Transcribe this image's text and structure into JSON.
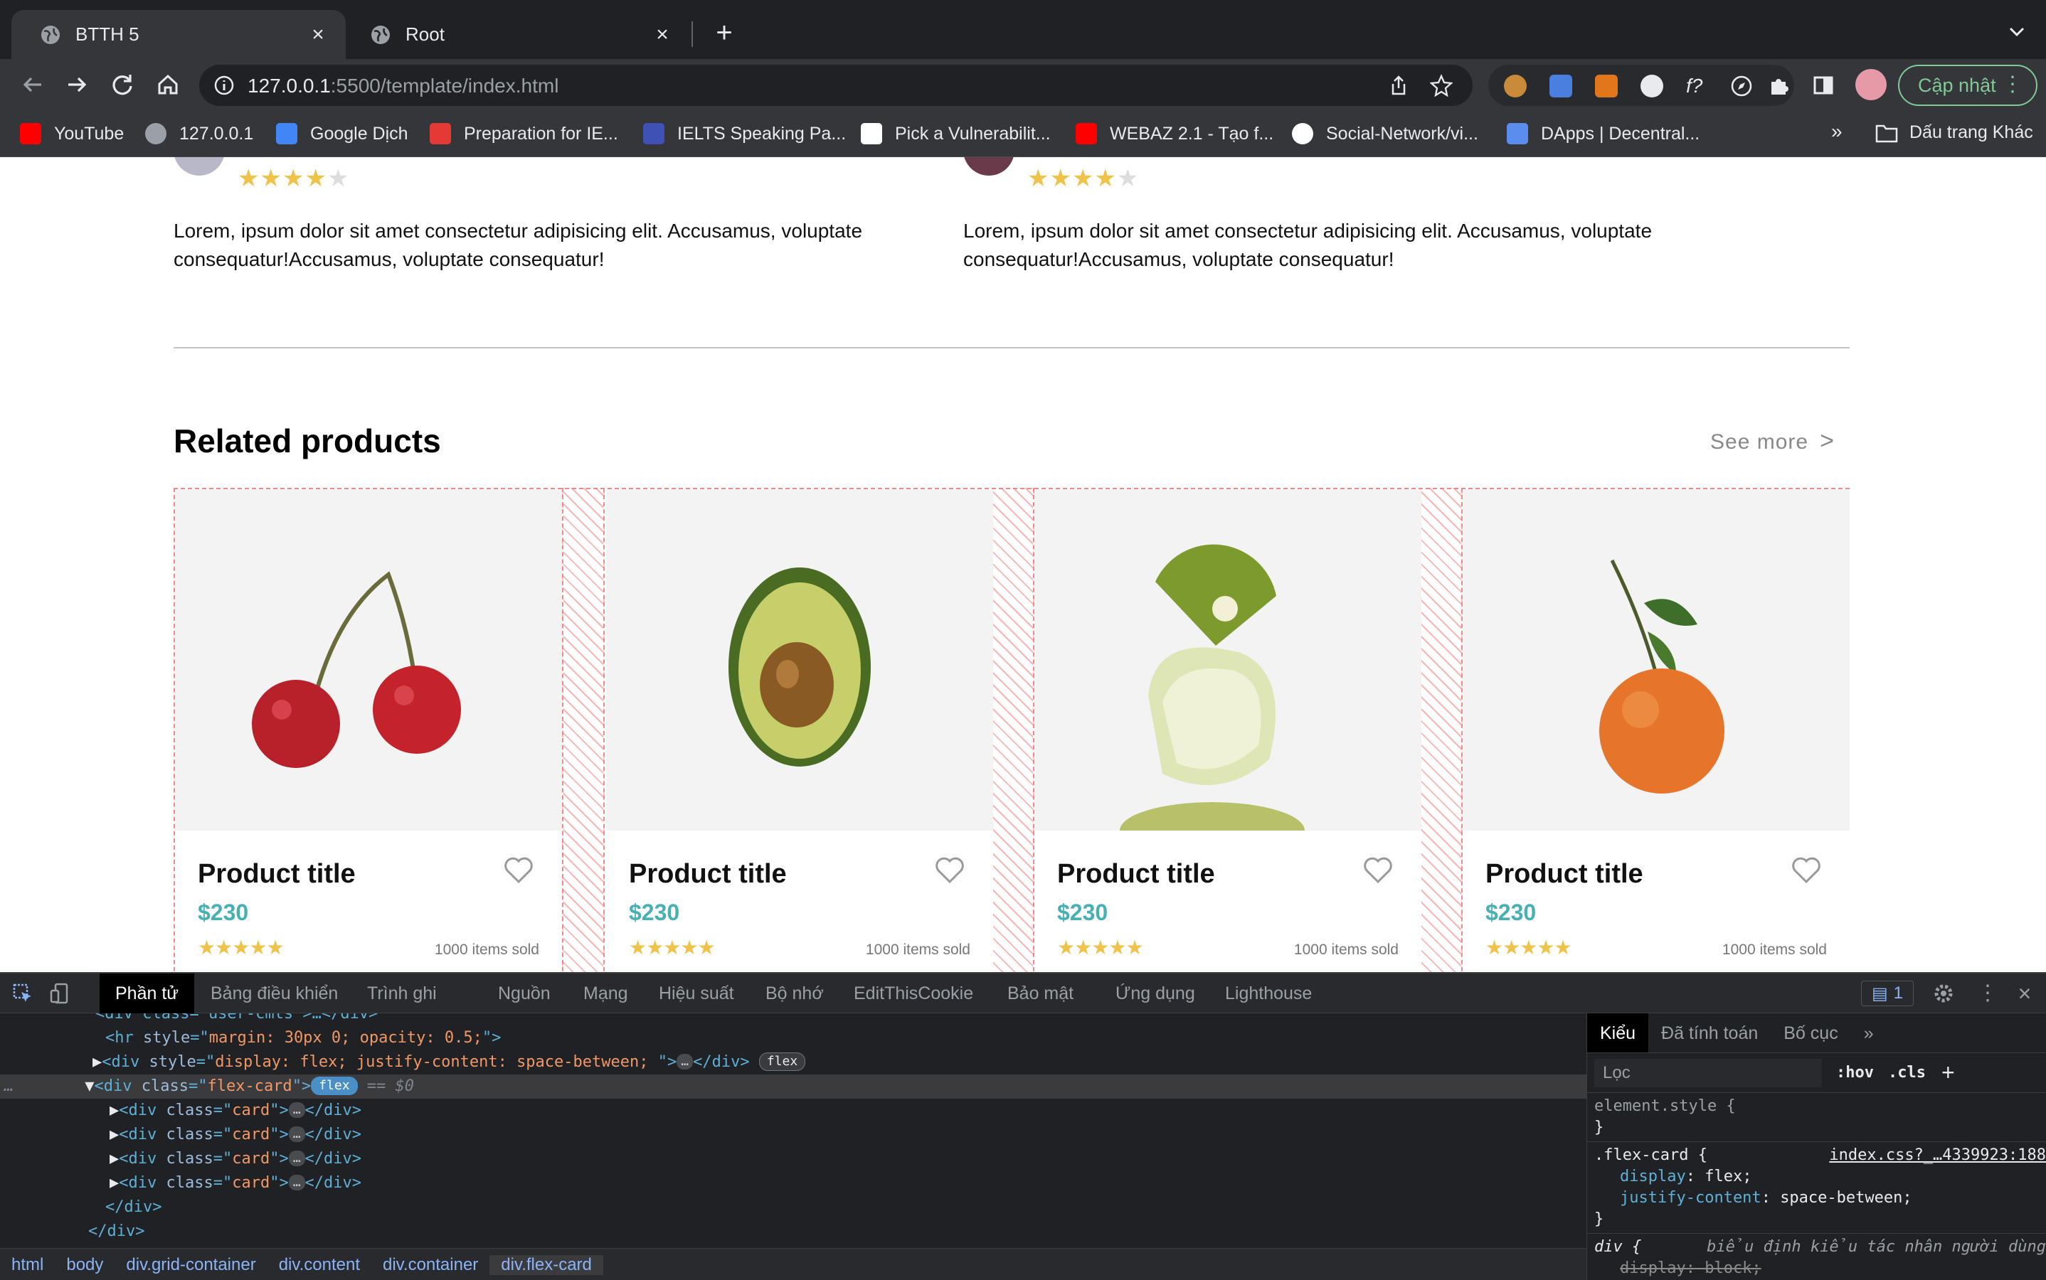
{
  "browser": {
    "tabs": [
      {
        "title": "BTTH 5",
        "active": true
      },
      {
        "title": "Root",
        "active": false
      }
    ],
    "url": {
      "host": "127.0.0.1",
      "rest": ":5500/template/index.html"
    },
    "update_button": "Cập nhật",
    "bookmarks": [
      {
        "label": "YouTube",
        "icon": "youtube-icon",
        "color": "#ff0000"
      },
      {
        "label": "127.0.0.1",
        "icon": "globe-icon",
        "color": "#9aa0a6"
      },
      {
        "label": "Google Dịch",
        "icon": "google-translate-icon",
        "color": "#4285f4"
      },
      {
        "label": "Preparation for IE...",
        "icon": "grid-icon",
        "color": "#e53935"
      },
      {
        "label": "IELTS Speaking Pa...",
        "icon": "ielts-icon",
        "color": "#3f51b5"
      },
      {
        "label": "Pick a Vulnerabilit...",
        "icon": "ha-icon",
        "color": "#ffffff"
      },
      {
        "label": "WEBAZ 2.1 - Tạo f...",
        "icon": "youtube-icon",
        "color": "#ff0000"
      },
      {
        "label": "Social-Network/vi...",
        "icon": "github-icon",
        "color": "#ffffff"
      },
      {
        "label": "DApps | Decentral...",
        "icon": "shield-icon",
        "color": "#5b8def"
      }
    ],
    "bookmarks_more": "»",
    "bookmarks_folder": "Dấu trang Khác"
  },
  "page": {
    "reviews": [
      {
        "text": "Lorem, ipsum dolor sit amet consectetur adipisicing elit. Accusamus, voluptate consequatur!Accusamus, voluptate consequatur!",
        "rating": 4.5
      },
      {
        "text": "Lorem, ipsum dolor sit amet consectetur adipisicing elit. Accusamus, voluptate consequatur!Accusamus, voluptate consequatur!",
        "rating": 4
      }
    ],
    "related_title": "Related products",
    "see_more": "See more",
    "products": [
      {
        "title": "Product title",
        "price": "$230",
        "sold": "1000 items sold",
        "image": "cherry",
        "rating": 5
      },
      {
        "title": "Product title",
        "price": "$230",
        "sold": "1000 items sold",
        "image": "avocado",
        "rating": 5
      },
      {
        "title": "Product title",
        "price": "$230",
        "sold": "1000 items sold",
        "image": "kiwi-lime",
        "rating": 5
      },
      {
        "title": "Product title",
        "price": "$230",
        "sold": "1000 items sold",
        "image": "tangerine",
        "rating": 5
      }
    ],
    "colors": {
      "price": "#47b0b5",
      "star": "#f0c24a",
      "flex_overlay": "#f08a8a"
    }
  },
  "devtools": {
    "tabs": [
      "Phần tử",
      "Bảng điều khiển",
      "Trình ghi",
      "Nguồn",
      "Mạng",
      "Hiệu suất",
      "Bộ nhớ",
      "EditThisCookie",
      "Bảo mật",
      "Ứng dụng",
      "Lighthouse"
    ],
    "issues_count": "1",
    "dom_lines": {
      "line0": "<div class=\"user-cmts\">…</div>",
      "hr_style": "margin: 30px 0; opacity: 0.5;",
      "div_style": "display: flex; justify-content: space-between; ",
      "flex_class": "flex-card",
      "card_class": "card",
      "badge": "flex",
      "selected_suffix": "== $0",
      "close_div": "</div>"
    },
    "breadcrumbs": [
      "html",
      "body",
      "div.grid-container",
      "div.content",
      "div.container",
      "div.flex-card"
    ],
    "styles_tabs": [
      "Kiểu",
      "Đã tính toán",
      "Bố cục",
      "»"
    ],
    "filter_placeholder": "Lọc",
    "hov": ":hov",
    "cls": ".cls",
    "rules": {
      "element_style": "element.style {",
      "flex_selector": ".flex-card {",
      "flex_source": "index.css?_…4339923:188",
      "display": "display",
      "display_val": "flex;",
      "jc": "justify-content",
      "jc_val": "space-between;",
      "ua_selector": "div {",
      "ua_label": "biểu định kiểu tác nhân người dùng",
      "ua_prop": "display: block;",
      "close": "}"
    }
  }
}
